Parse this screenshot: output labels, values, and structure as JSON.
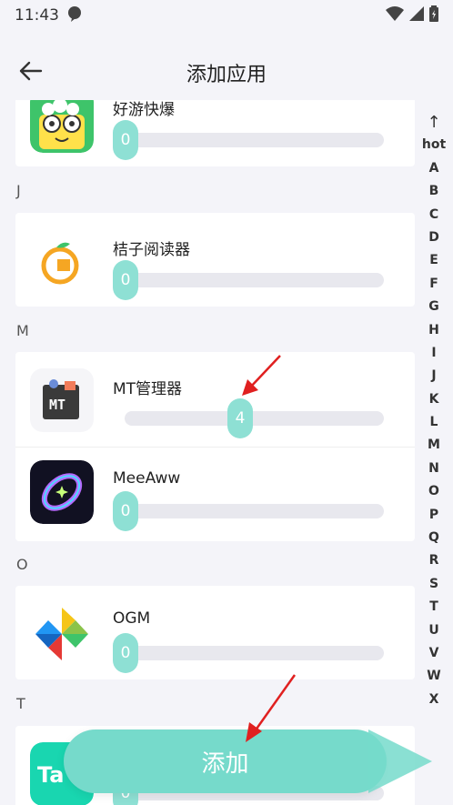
{
  "status_bar": {
    "time": "11:43"
  },
  "header": {
    "title": "添加应用"
  },
  "sections": [
    {
      "letter": "",
      "apps": [
        {
          "name": "好游快爆",
          "value": 0
        }
      ]
    },
    {
      "letter": "J",
      "apps": [
        {
          "name": "桔子阅读器",
          "value": 0
        }
      ]
    },
    {
      "letter": "M",
      "apps": [
        {
          "name": "MT管理器",
          "value": 4
        },
        {
          "name": "MeeAww",
          "value": 0
        }
      ]
    },
    {
      "letter": "O",
      "apps": [
        {
          "name": "OGM",
          "value": 0
        }
      ]
    },
    {
      "letter": "T",
      "apps": [
        {
          "name": "",
          "value": 0
        }
      ]
    }
  ],
  "alpha_index": [
    "↑",
    "hot",
    "A",
    "B",
    "C",
    "D",
    "E",
    "F",
    "G",
    "H",
    "I",
    "J",
    "K",
    "L",
    "M",
    "N",
    "O",
    "P",
    "Q",
    "R",
    "S",
    "T",
    "U",
    "V",
    "W",
    "X"
  ],
  "add_button": {
    "label": "添加"
  },
  "colors": {
    "accent": "#76dacb",
    "thumb": "#8ee0d4",
    "arrow": "#e02020"
  }
}
